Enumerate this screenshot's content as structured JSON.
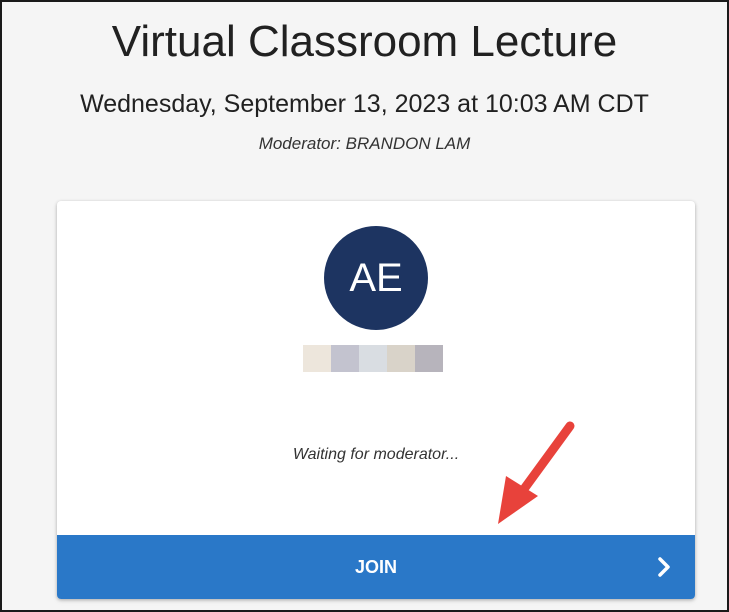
{
  "header": {
    "title": "Virtual Classroom Lecture",
    "datetime": "Wednesday, September 13, 2023 at 10:03 AM CDT",
    "moderator": "Moderator: BRANDON LAM"
  },
  "card": {
    "avatar_initials": "AE",
    "status": "Waiting for moderator...",
    "join_label": "JOIN"
  },
  "icons": {
    "join_chevron": "chevron-right-icon",
    "annotation": "red-arrow-annotation"
  },
  "colors": {
    "avatar_bg": "#1d3461",
    "join_bg": "#2a78c8",
    "annotation_arrow": "#e8423b",
    "name_blur": [
      "#ede6dc",
      "#c3c3cf",
      "#d9dde2",
      "#d9d3c9",
      "#b7b4bc"
    ]
  }
}
